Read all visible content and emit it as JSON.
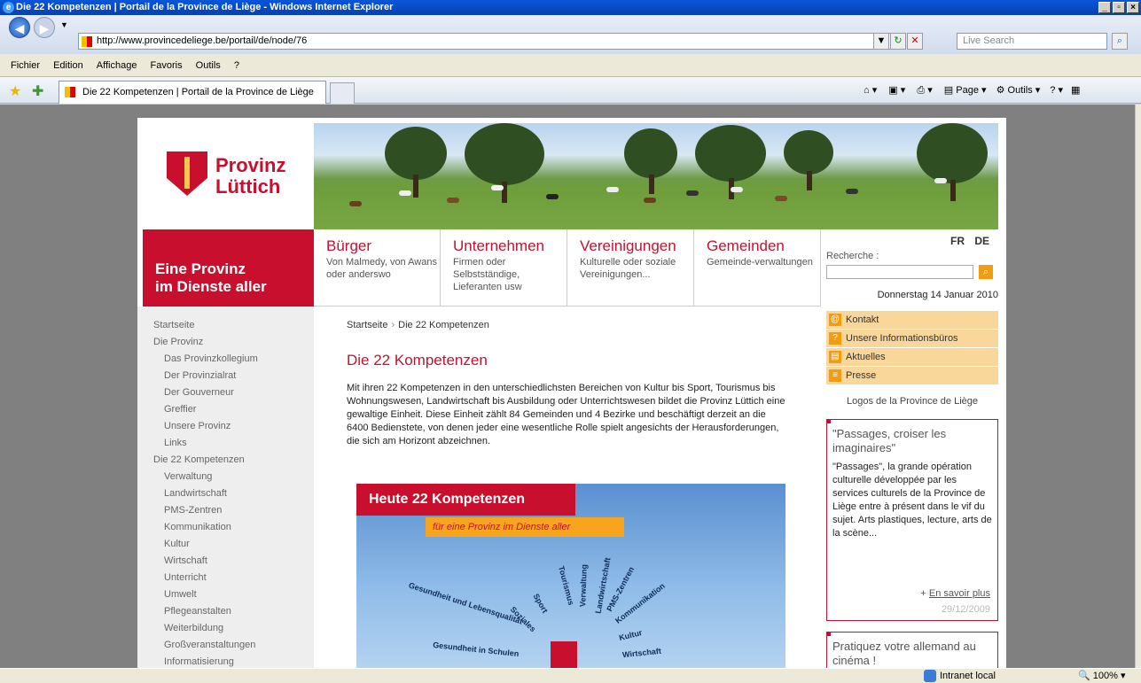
{
  "window": {
    "title": "Die 22 Kompetenzen | Portail de la Province de Liège - Windows Internet Explorer",
    "url": "http://www.provincedeliege.be/portail/de/node/76",
    "search_placeholder": "Live Search"
  },
  "menu": [
    "Fichier",
    "Edition",
    "Affichage",
    "Favoris",
    "Outils",
    "?"
  ],
  "tab": {
    "label": "Die 22 Kompetenzen | Portail de la Province de Liège"
  },
  "toolbar": {
    "page": "Page",
    "tools": "Outils"
  },
  "status": {
    "zone": "Intranet local",
    "zoom": "100%"
  },
  "site": {
    "logo_line1": "Provinz",
    "logo_line2": "Lüttich",
    "slogan_line1": "Eine Provinz",
    "slogan_line2": "im Dienste aller",
    "nav": [
      {
        "title": "Bürger",
        "sub": "Von Malmedy, von Awans oder anderswo"
      },
      {
        "title": "Unternehmen",
        "sub": "Firmen oder Selbstständige, Lieferanten usw"
      },
      {
        "title": "Vereinigungen",
        "sub": "Kulturelle oder soziale Vereinigungen..."
      },
      {
        "title": "Gemeinden",
        "sub": "Gemeinde-verwaltungen"
      }
    ],
    "lang": [
      "FR",
      "DE"
    ],
    "search_label": "Recherche :",
    "date": "Donnerstag 14 Januar 2010"
  },
  "leftnav": [
    {
      "label": "Startseite",
      "level": 0
    },
    {
      "label": "Die Provinz",
      "level": 0
    },
    {
      "label": "Das Provinzkollegium",
      "level": 1
    },
    {
      "label": "Der Provinzialrat",
      "level": 1
    },
    {
      "label": "Der Gouverneur",
      "level": 1
    },
    {
      "label": "Greffier",
      "level": 1
    },
    {
      "label": "Unsere Provinz",
      "level": 1
    },
    {
      "label": "Links",
      "level": 1
    },
    {
      "label": "Die 22 Kompetenzen",
      "level": 0
    },
    {
      "label": "Verwaltung",
      "level": 1
    },
    {
      "label": "Landwirtschaft",
      "level": 1
    },
    {
      "label": "PMS-Zentren",
      "level": 1
    },
    {
      "label": "Kommunikation",
      "level": 1
    },
    {
      "label": "Kultur",
      "level": 1
    },
    {
      "label": "Wirtschaft",
      "level": 1
    },
    {
      "label": "Unterricht",
      "level": 1
    },
    {
      "label": "Umwelt",
      "level": 1
    },
    {
      "label": "Pflegeanstalten",
      "level": 1
    },
    {
      "label": "Weiterbildung",
      "level": 1
    },
    {
      "label": "Großveranstaltungen",
      "level": 1
    },
    {
      "label": "Informatisierung",
      "level": 1
    }
  ],
  "main": {
    "breadcrumb_home": "Startseite",
    "breadcrumb_sep": "›",
    "breadcrumb_current": "Die 22 Kompetenzen",
    "title": "Die 22 Kompetenzen",
    "intro": "Mit ihren 22 Kompetenzen in den unterschiedlichsten Bereichen von Kultur bis Sport, Tourismus bis Wohnungswesen, Landwirtschaft bis Ausbildung oder Unterrichtswesen bildet die Provinz Lüttich eine gewaltige Einheit. Diese Einheit zählt 84 Gemeinden und 4 Bezirke und beschäftigt derzeit an die 6400 Bedienstete, von denen jeder eine wesentliche Rolle spielt angesichts der Herausforderungen, die sich am Horizont abzeichnen.",
    "poster_title": "Heute 22 Kompetenzen",
    "poster_sub": "für eine Provinz im Dienste aller",
    "poster_words": [
      "Gesundheit und Lebensqualität",
      "Soziales",
      "Sport",
      "Tourismus",
      "Verwaltung",
      "Landwirtschaft",
      "PMS-Zentren",
      "Kommunikation",
      "Kultur",
      "Wirtschaft",
      "Gesundheit in Schulen"
    ]
  },
  "right": {
    "links": [
      {
        "label": "Kontakt",
        "icon": "at-icon"
      },
      {
        "label": "Unsere Informationsbüros",
        "icon": "question-icon"
      },
      {
        "label": "Aktuelles",
        "icon": "news-icon"
      },
      {
        "label": "Presse",
        "icon": "list-icon"
      }
    ],
    "logos": "Logos de la Province de Liège",
    "box1": {
      "title": "\"Passages, croiser les imaginaires\"",
      "body": "\"Passages\", la grande opération culturelle développée par les services culturels de la Province de Liège entre à présent dans le vif du sujet. Arts plastiques, lecture, arts de la scène...",
      "more_prefix": "+ ",
      "more": "En savoir plus",
      "date": "29/12/2009"
    },
    "box2": {
      "title": "Pratiquez votre allemand au cinéma !"
    }
  }
}
